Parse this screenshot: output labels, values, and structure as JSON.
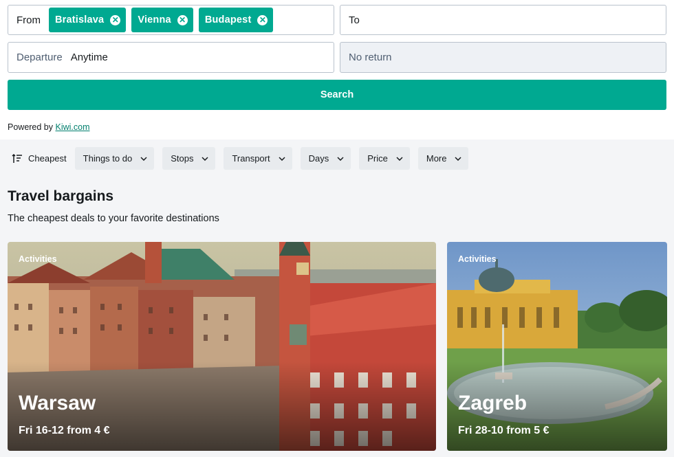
{
  "search": {
    "from_label": "From",
    "from_chips": [
      "Bratislava",
      "Vienna",
      "Budapest"
    ],
    "to_label": "To",
    "departure_label": "Departure",
    "departure_value": "Anytime",
    "return_label": "No return",
    "search_button": "Search"
  },
  "powered": {
    "prefix": "Powered by ",
    "link": "Kiwi.com"
  },
  "filters": {
    "sort_label": "Cheapest",
    "buttons": [
      "Things to do",
      "Stops",
      "Transport",
      "Days",
      "Price",
      "More"
    ]
  },
  "section": {
    "title": "Travel bargains",
    "subtitle": "The cheapest deals to your favorite destinations"
  },
  "cards": [
    {
      "tag": "Activities",
      "city": "Warsaw",
      "info": "Fri 16-12 from 4 €"
    },
    {
      "tag": "Activities",
      "city": "Zagreb",
      "info": "Fri 28-10 from 5 €"
    }
  ],
  "colors": {
    "accent": "#00a991",
    "link": "#007f6d"
  }
}
